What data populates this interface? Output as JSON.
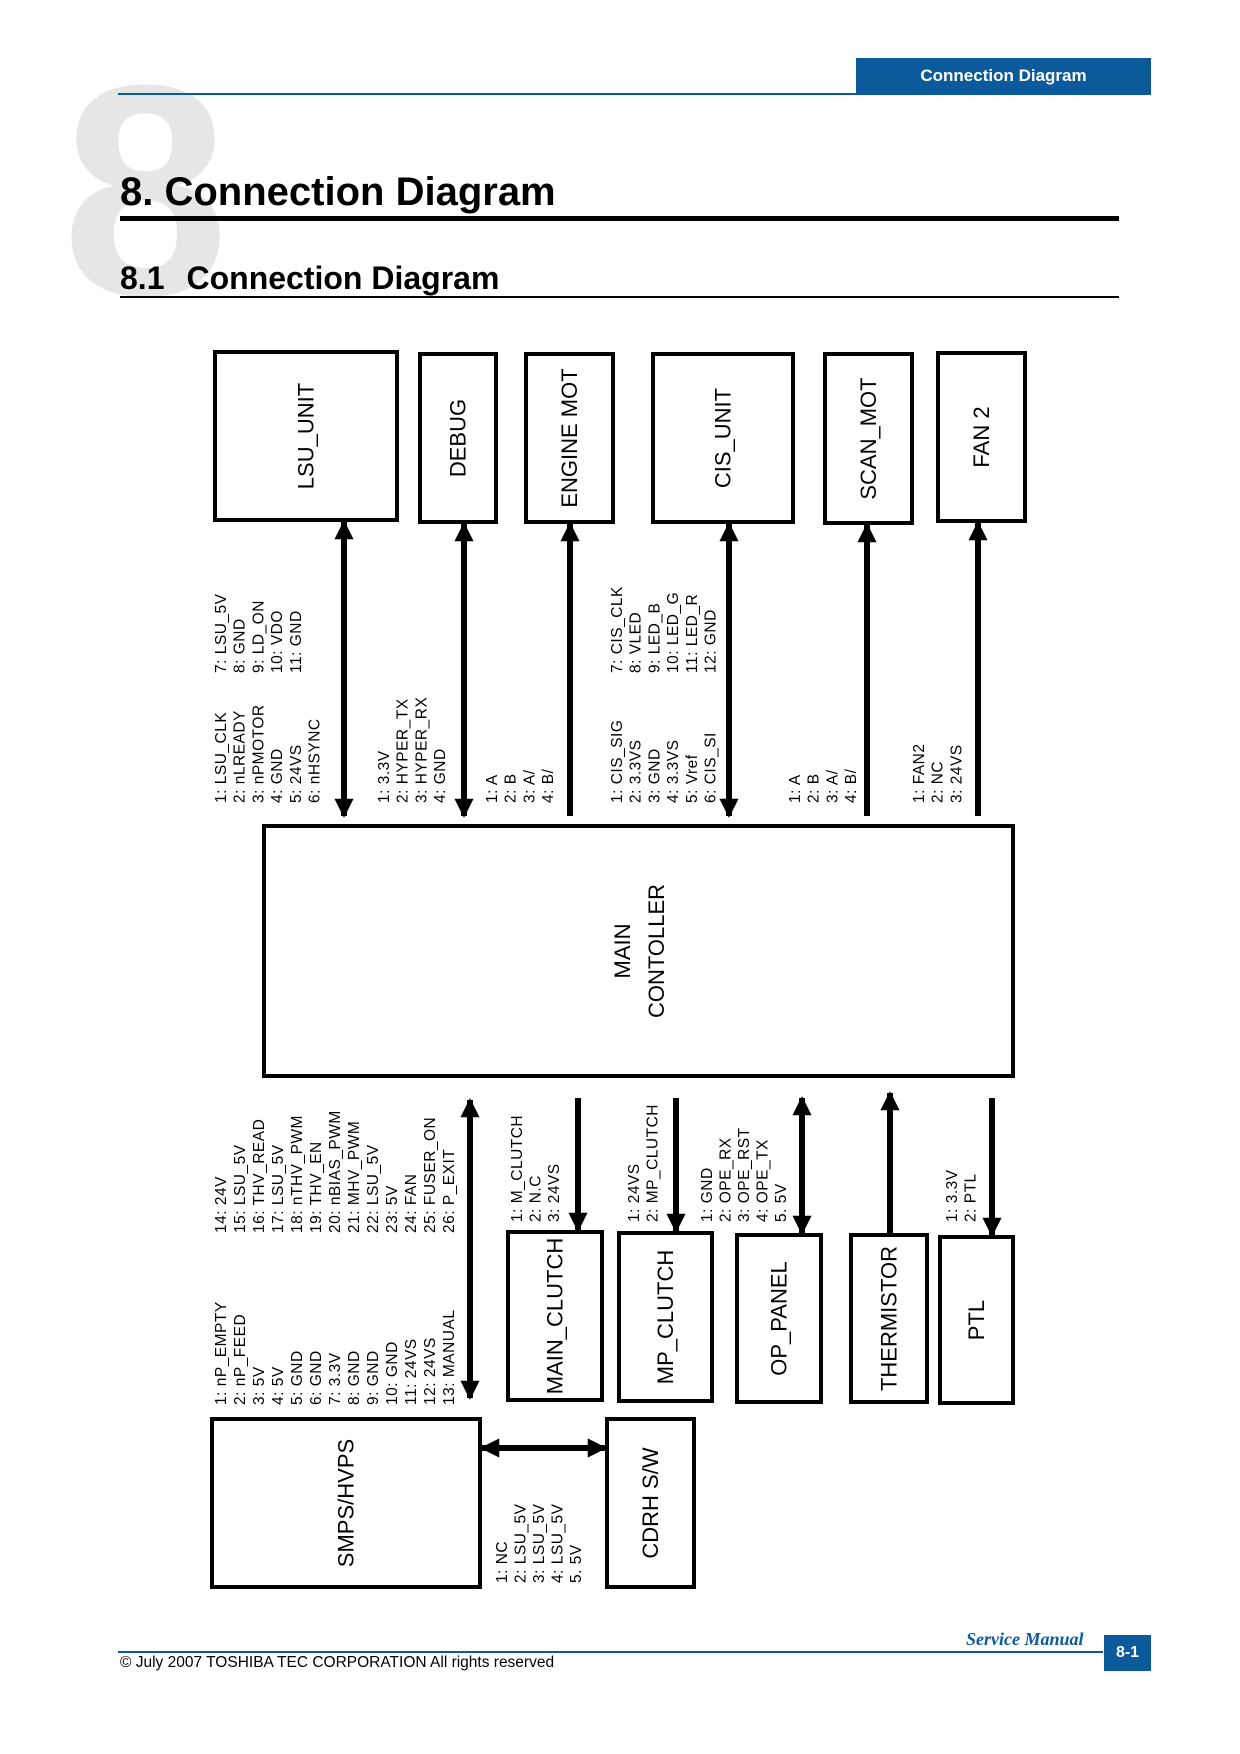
{
  "header": {
    "banner": "Connection Diagram",
    "chapter_number": "8"
  },
  "title": "8. Connection Diagram",
  "subtitle": {
    "number": "8.1",
    "text": "Connection Diagram"
  },
  "diagram": {
    "main": {
      "line1": "MAIN",
      "line2": "CONTOLLER"
    },
    "top_units": [
      {
        "name": "LSU_UNIT",
        "direction": "bidirectional",
        "pins": [
          "1:  LSU_CLK",
          "2:  nLREADY",
          "3:  nPMOTOR",
          "4:  GND",
          "5:  24VS",
          "6:  nHSYNC"
        ],
        "pins2": [
          "7:  LSU_5V",
          "8:  GND",
          "9:  LD_ON",
          "10:  VDO",
          "11:  GND"
        ]
      },
      {
        "name": "DEBUG",
        "direction": "bidirectional",
        "pins": [
          "1:  3.3V",
          "2:  HYPER_TX",
          "3:  HYPER_RX",
          "4:  GND"
        ]
      },
      {
        "name": "ENGINE  MOT",
        "direction": "to-unit",
        "pins": [
          "1:  A",
          "2:  B",
          "3:  A/",
          "4:  B/"
        ]
      },
      {
        "name": "CIS_UNIT",
        "direction": "bidirectional",
        "pins": [
          "1:  CIS_SIG",
          "2:  3.3VS",
          "3:  GND",
          "4:  3.3VS",
          "5:  Vref",
          "6:  CIS_SI"
        ],
        "pins2": [
          "7:  CIS_CLK",
          "8:  VLED",
          "9:  LED_B",
          "10:  LED_G",
          "11:  LED_R",
          "12:  GND"
        ]
      },
      {
        "name": "SCAN_MOT",
        "direction": "to-unit",
        "pins": [
          "1:  A",
          "2:  B",
          "3:  A/",
          "4:  B/"
        ]
      },
      {
        "name": "FAN 2",
        "direction": "to-unit",
        "pins": [
          "1:  FAN2",
          "2:  NC",
          "3:  24VS"
        ]
      }
    ],
    "smps": {
      "name": "SMPS/HVPS",
      "direction": "bidirectional",
      "pins": [
        "1:  nP_EMPTY",
        "2:  nP_FEED",
        "3:  5V",
        "4:  5V",
        "5:  GND",
        "6:  GND",
        "7:  3.3V",
        "8:  GND",
        "9:  GND",
        "10:  GND",
        "11:  24VS",
        "12:  24VS",
        "13:  MANUAL"
      ],
      "pins2": [
        "14:  24V",
        "15:  LSU_5V",
        "16:  THV_READ",
        "17:  LSU_5V",
        "18:  nTHV_PWM",
        "19:  THV_EN",
        "20:  nBIAS_PWM",
        "21:  MHV_PWM",
        "22:  LSU_5V",
        "23:  5V",
        "24:  FAN",
        "25:  FUSER_ON",
        "26:  P_EXIT"
      ]
    },
    "bottom_units": [
      {
        "name": "MAIN_CLUTCH",
        "direction": "to-unit",
        "pins": [
          "1:  M_CLUTCH",
          "2:  N.C",
          "3:  24VS"
        ]
      },
      {
        "name": "MP_CLUTCH",
        "direction": "to-unit",
        "pins": [
          "1:  24VS",
          "2:  MP_CLUTCH"
        ]
      },
      {
        "name": "OP_PANEL",
        "direction": "bidirectional",
        "pins": [
          "1:  GND",
          "2:  OPE_RX",
          "3:  OPE_RST",
          "4:  OPE_TX",
          "5.  5V"
        ]
      },
      {
        "name": "THERMISTOR",
        "direction": "to-controller",
        "pins": []
      },
      {
        "name": "PTL",
        "direction": "to-unit",
        "pins": [
          "1:  3.3V",
          "2:  PTL"
        ]
      }
    ],
    "cdrh": {
      "name": "CDRH  S/W",
      "direction": "bidirectional",
      "pins": [
        "1:  NC",
        "2:  LSU_5V",
        "3:  LSU_5V",
        "4:  LSU_5V",
        "5.  5V"
      ]
    }
  },
  "footer": {
    "copyright": "© July 2007 TOSHIBA TEC CORPORATION All rights reserved",
    "manual": "Service Manual",
    "page": "8-1"
  },
  "colors": {
    "brand_blue": "#0a5a9c",
    "chapter_watermark": "#e6e6e6"
  }
}
